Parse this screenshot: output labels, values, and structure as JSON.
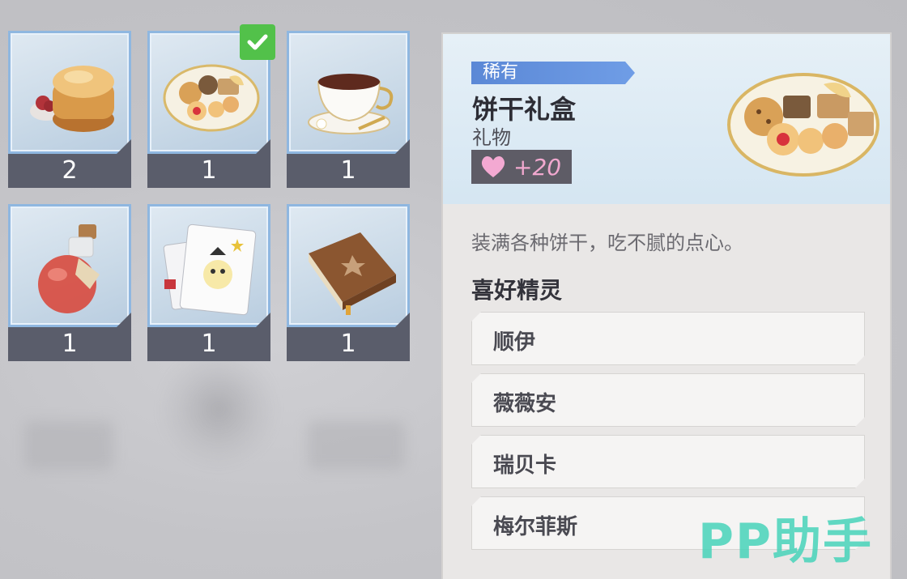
{
  "inventory": {
    "items": [
      {
        "name": "scone",
        "icon": "scone-icon",
        "count": "2"
      },
      {
        "name": "cookie-gift-box",
        "icon": "cookie-plate-icon",
        "count": "1",
        "selected": true
      },
      {
        "name": "teacup",
        "icon": "teacup-icon",
        "count": "1"
      },
      {
        "name": "potion",
        "icon": "potion-bottle-icon",
        "count": "1"
      },
      {
        "name": "playing-cards",
        "icon": "joker-cards-icon",
        "count": "1"
      },
      {
        "name": "book",
        "icon": "book-icon",
        "count": "1"
      }
    ]
  },
  "detail": {
    "rarity": "稀有",
    "name": "饼干礼盒",
    "type": "礼物",
    "favor": "+20",
    "description": "装满各种饼干，吃不腻的点心。",
    "liked_title": "喜好精灵",
    "liked_sprites": [
      "顺伊",
      "薇薇安",
      "瑞贝卡",
      "梅尔菲斯"
    ]
  },
  "watermark": "PP助手",
  "colors": {
    "rarity_blue": "#5b88d6",
    "check_green": "#52c14a",
    "heart_pink": "#f1a8cf",
    "watermark_teal": "#46d2b9"
  }
}
